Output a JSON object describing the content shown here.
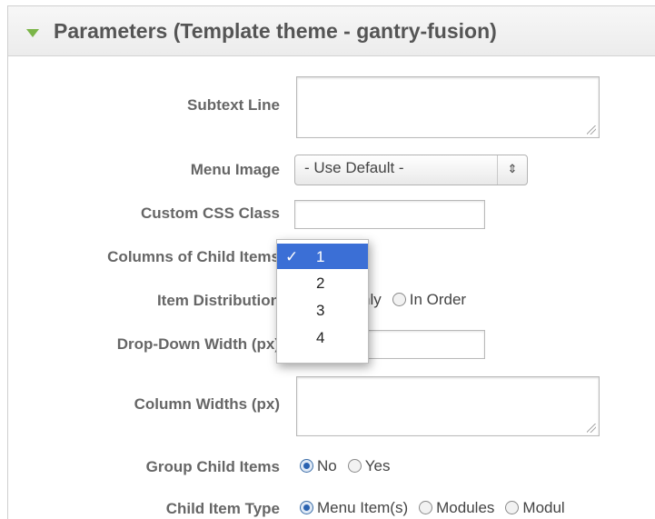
{
  "header": {
    "title": "Parameters (Template theme - gantry-fusion)"
  },
  "fields": {
    "subtext_line": {
      "label": "Subtext Line",
      "value": ""
    },
    "menu_image": {
      "label": "Menu Image",
      "selected": "- Use Default -"
    },
    "custom_css_class": {
      "label": "Custom CSS Class",
      "value": ""
    },
    "columns_child_items": {
      "label": "Columns of Child Items"
    },
    "item_distribution": {
      "label": "Item Distribution",
      "options": [
        "Evenly",
        "In Order"
      ],
      "selected": "Evenly",
      "visible_fragment": "nly"
    },
    "dropdown_width": {
      "label": "Drop-Down Width (px)",
      "value": ""
    },
    "column_widths": {
      "label": "Column Widths (px)",
      "value": ""
    },
    "group_child_items": {
      "label": "Group Child Items",
      "options": [
        "No",
        "Yes"
      ],
      "selected": "No"
    },
    "child_item_type": {
      "label": "Child Item Type",
      "options": [
        "Menu Item(s)",
        "Modules",
        "Modul"
      ],
      "selected": "Menu Item(s)"
    }
  },
  "columns_dropdown": {
    "check": "✓",
    "options": [
      "1",
      "2",
      "3",
      "4"
    ],
    "selected": "1"
  },
  "colors": {
    "accent_triangle": "#7bb548",
    "highlight": "#3b6fd6"
  }
}
